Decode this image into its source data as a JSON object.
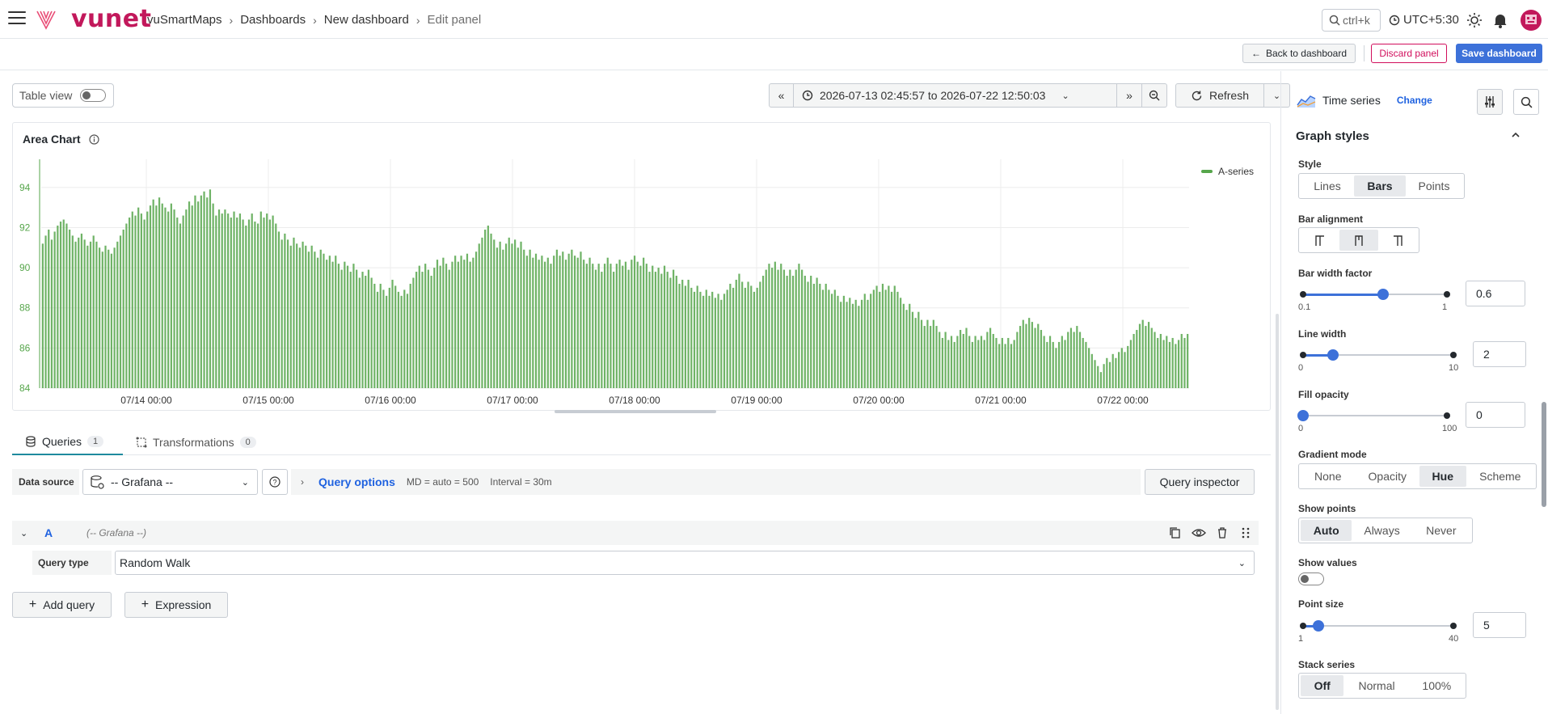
{
  "header": {
    "brand": "vunet",
    "breadcrumb": [
      "vuSmartMaps",
      "Dashboards",
      "New dashboard",
      "Edit panel"
    ],
    "search_hint": "ctrl+k",
    "timezone": "UTC+5:30"
  },
  "toolbar": {
    "back_label": "Back to dashboard",
    "discard_label": "Discard panel",
    "save_label": "Save dashboard"
  },
  "controls": {
    "table_view_label": "Table view",
    "table_view_on": false,
    "time_range": "2026-07-13 02:45:57 to 2026-07-22 12:50:03",
    "refresh_label": "Refresh"
  },
  "panel": {
    "title": "Area Chart"
  },
  "chart_data": {
    "type": "bar",
    "title": "Area Chart",
    "ylim": [
      84,
      95
    ],
    "yticks": [
      84,
      86,
      88,
      90,
      92,
      94
    ],
    "xticks": [
      "07/14 00:00",
      "07/15 00:00",
      "07/16 00:00",
      "07/17 00:00",
      "07/18 00:00",
      "07/19 00:00",
      "07/20 00:00",
      "07/21 00:00",
      "07/22 00:00"
    ],
    "series": [
      {
        "name": "A-series",
        "color": "#56a64b",
        "values": [
          91.2,
          91.6,
          91.9,
          91.4,
          91.8,
          92.1,
          92.3,
          92.4,
          92.2,
          91.9,
          91.6,
          91.3,
          91.5,
          91.7,
          91.4,
          91.1,
          91.3,
          91.6,
          91.3,
          91.0,
          90.8,
          91.1,
          90.9,
          90.7,
          91.0,
          91.3,
          91.6,
          91.9,
          92.2,
          92.5,
          92.8,
          92.6,
          93.0,
          92.7,
          92.4,
          92.8,
          93.1,
          93.4,
          93.1,
          93.5,
          93.2,
          93.0,
          92.8,
          93.2,
          92.9,
          92.5,
          92.2,
          92.6,
          92.9,
          93.3,
          93.1,
          93.6,
          93.3,
          93.6,
          93.8,
          93.5,
          93.9,
          93.2,
          92.6,
          92.9,
          92.7,
          92.9,
          92.7,
          92.5,
          92.8,
          92.5,
          92.7,
          92.4,
          92.1,
          92.4,
          92.7,
          92.3,
          92.2,
          92.8,
          92.5,
          92.7,
          92.4,
          92.6,
          92.2,
          91.8,
          91.4,
          91.7,
          91.4,
          91.1,
          91.5,
          91.2,
          91.0,
          91.3,
          91.1,
          90.8,
          91.1,
          90.8,
          90.5,
          90.9,
          90.7,
          90.4,
          90.6,
          90.3,
          90.6,
          90.2,
          89.9,
          90.3,
          90.1,
          89.8,
          90.2,
          89.9,
          89.5,
          89.8,
          89.6,
          89.9,
          89.5,
          89.2,
          88.8,
          89.2,
          88.9,
          88.6,
          89.0,
          89.4,
          89.1,
          88.8,
          88.6,
          88.9,
          88.7,
          89.2,
          89.5,
          89.8,
          90.1,
          89.8,
          90.2,
          89.9,
          89.6,
          90.0,
          90.4,
          90.1,
          90.5,
          90.2,
          89.9,
          90.3,
          90.6,
          90.3,
          90.6,
          90.4,
          90.7,
          90.3,
          90.5,
          90.8,
          91.2,
          91.5,
          91.9,
          92.1,
          91.7,
          91.4,
          91.0,
          91.3,
          90.9,
          91.2,
          91.5,
          91.2,
          91.4,
          91.0,
          91.3,
          90.9,
          90.6,
          90.9,
          90.5,
          90.7,
          90.4,
          90.6,
          90.3,
          90.5,
          90.2,
          90.6,
          90.9,
          90.6,
          90.8,
          90.4,
          90.7,
          90.9,
          90.6,
          90.5,
          90.8,
          90.4,
          90.2,
          90.5,
          90.2,
          89.9,
          90.2,
          89.8,
          90.2,
          90.5,
          90.2,
          89.8,
          90.2,
          90.4,
          90.1,
          90.3,
          89.9,
          90.4,
          90.6,
          90.3,
          90.1,
          90.5,
          90.2,
          89.8,
          90.1,
          89.8,
          90.0,
          89.7,
          90.1,
          89.8,
          89.5,
          89.9,
          89.6,
          89.2,
          89.4,
          89.1,
          89.4,
          89.0,
          88.8,
          89.1,
          88.8,
          88.6,
          88.9,
          88.6,
          88.8,
          88.5,
          88.7,
          88.4,
          88.7,
          88.9,
          89.2,
          89.0,
          89.4,
          89.7,
          89.3,
          89.0,
          89.3,
          89.1,
          88.8,
          89.0,
          89.3,
          89.6,
          89.9,
          90.2,
          90.0,
          90.3,
          89.9,
          90.2,
          89.9,
          89.6,
          89.9,
          89.6,
          89.9,
          90.2,
          89.9,
          89.6,
          89.3,
          89.6,
          89.2,
          89.5,
          89.2,
          88.9,
          89.2,
          88.9,
          88.7,
          88.9,
          88.6,
          88.3,
          88.6,
          88.3,
          88.5,
          88.2,
          88.4,
          88.1,
          88.4,
          88.7,
          88.4,
          88.7,
          88.9,
          89.1,
          88.8,
          89.2,
          88.9,
          89.1,
          88.8,
          89.1,
          88.8,
          88.5,
          88.2,
          87.9,
          88.2,
          87.8,
          87.5,
          87.8,
          87.4,
          87.1,
          87.4,
          87.1,
          87.4,
          87.1,
          86.8,
          86.5,
          86.8,
          86.4,
          86.6,
          86.3,
          86.6,
          86.9,
          86.7,
          87.0,
          86.6,
          86.3,
          86.6,
          86.4,
          86.6,
          86.4,
          86.8,
          87.0,
          86.7,
          86.5,
          86.2,
          86.5,
          86.2,
          86.5,
          86.2,
          86.4,
          86.8,
          87.1,
          87.4,
          87.2,
          87.5,
          87.3,
          87.0,
          87.2,
          86.9,
          86.6,
          86.3,
          86.6,
          86.3,
          86.0,
          86.3,
          86.6,
          86.4,
          86.8,
          87.0,
          86.8,
          87.1,
          86.8,
          86.5,
          86.3,
          86.0,
          85.7,
          85.4,
          85.1,
          84.8,
          85.2,
          85.5,
          85.3,
          85.7,
          85.5,
          85.8,
          86.0,
          85.8,
          86.1,
          86.4,
          86.7,
          86.9,
          87.2,
          87.4,
          87.1,
          87.3,
          87.0,
          86.8,
          86.5,
          86.7,
          86.4,
          86.6,
          86.3,
          86.5,
          86.2,
          86.4,
          86.7,
          86.5,
          86.7
        ]
      }
    ],
    "legend_position": "top-right",
    "grid": true
  },
  "query_tabs": [
    {
      "label": "Queries",
      "count": "1"
    },
    {
      "label": "Transformations",
      "count": "0"
    }
  ],
  "datasource": {
    "label": "Data source",
    "value": "-- Grafana --",
    "query_options_label": "Query options",
    "md": "MD = auto = 500",
    "interval": "Interval = 30m",
    "inspector_label": "Query inspector"
  },
  "query": {
    "letter": "A",
    "source": "(-- Grafana --)",
    "type_label": "Query type",
    "type_value": "Random Walk",
    "add_query_label": "Add query",
    "expression_label": "Expression"
  },
  "options": {
    "viz_name": "Time series",
    "change_label": "Change",
    "section_title": "Graph styles",
    "style": {
      "label": "Style",
      "options": [
        "Lines",
        "Bars",
        "Points"
      ],
      "selected": "Bars"
    },
    "bar_alignment": {
      "label": "Bar alignment"
    },
    "bar_width": {
      "label": "Bar width factor",
      "min": "0.1",
      "max": "1",
      "value": "0.6",
      "fraction": 0.556
    },
    "line_width": {
      "label": "Line width",
      "min": "0",
      "max": "10",
      "value": "2",
      "fraction": 0.2
    },
    "fill_opacity": {
      "label": "Fill opacity",
      "min": "0",
      "max": "100",
      "value": "0",
      "fraction": 0
    },
    "gradient_mode": {
      "label": "Gradient mode",
      "options": [
        "None",
        "Opacity",
        "Hue",
        "Scheme"
      ],
      "selected": "Hue"
    },
    "show_points": {
      "label": "Show points",
      "options": [
        "Auto",
        "Always",
        "Never"
      ],
      "selected": "Auto"
    },
    "show_values": {
      "label": "Show values",
      "on": false
    },
    "point_size": {
      "label": "Point size",
      "min": "1",
      "max": "40",
      "value": "5",
      "fraction": 0.103
    },
    "stack_series": {
      "label": "Stack series",
      "options": [
        "Off",
        "Normal",
        "100%"
      ],
      "selected": "Off"
    }
  }
}
